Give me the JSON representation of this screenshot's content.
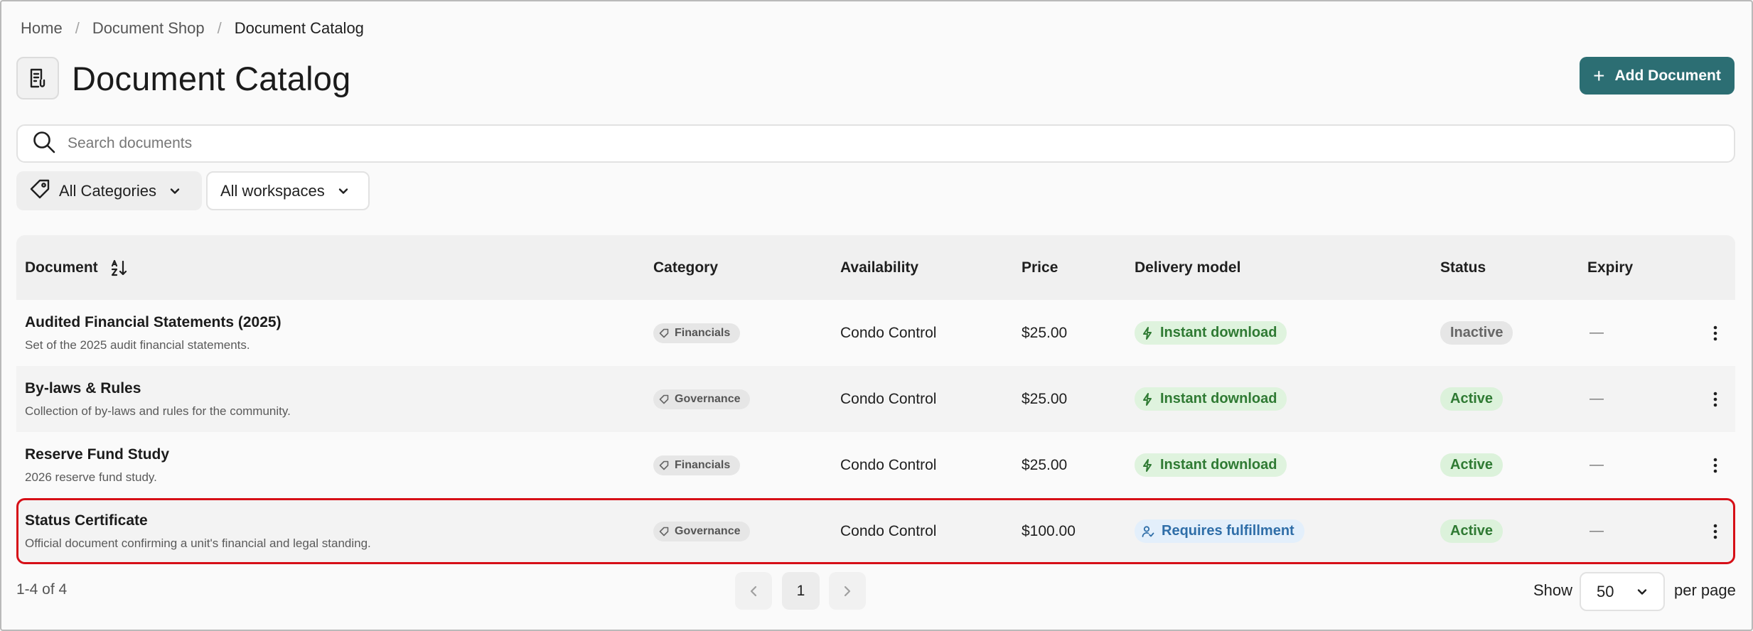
{
  "breadcrumb": {
    "items": [
      "Home",
      "Document Shop",
      "Document Catalog"
    ],
    "separator": "/"
  },
  "header": {
    "title": "Document Catalog",
    "icon": "document-list-icon",
    "add_button": "Add Document"
  },
  "search": {
    "placeholder": "Search documents",
    "value": ""
  },
  "filters": {
    "category": "All Categories",
    "workspace": "All workspaces"
  },
  "table": {
    "columns": [
      "Document",
      "Category",
      "Availability",
      "Price",
      "Delivery model",
      "Status",
      "Expiry"
    ],
    "rows": [
      {
        "title": "Audited Financial Statements (2025)",
        "description": "Set of the 2025 audit financial statements.",
        "category": "Financials",
        "availability": "Condo Control",
        "price": "$25.00",
        "delivery": "Instant download",
        "delivery_type": "instant",
        "status": "Inactive",
        "expiry": "—"
      },
      {
        "title": "By-laws & Rules",
        "description": "Collection of by-laws and rules for the community.",
        "category": "Governance",
        "availability": "Condo Control",
        "price": "$25.00",
        "delivery": "Instant download",
        "delivery_type": "instant",
        "status": "Active",
        "expiry": "—"
      },
      {
        "title": "Reserve Fund Study",
        "description": "2026 reserve fund study.",
        "category": "Financials",
        "availability": "Condo Control",
        "price": "$25.00",
        "delivery": "Instant download",
        "delivery_type": "instant",
        "status": "Active",
        "expiry": "—"
      },
      {
        "title": "Status Certificate",
        "description": "Official document confirming a unit's financial and legal standing.",
        "category": "Governance",
        "availability": "Condo Control",
        "price": "$100.00",
        "delivery": "Requires fulfillment",
        "delivery_type": "fulfill",
        "status": "Active",
        "expiry": "—"
      }
    ]
  },
  "pagination": {
    "summary": "1-4 of 4",
    "current_page": "1",
    "show_label": "Show",
    "per_page": "50",
    "per_page_label": "per page"
  },
  "colors": {
    "accent": "#2c6e73",
    "highlight": "#d60f17",
    "success": "#2f7a33",
    "info": "#2f6ea8"
  }
}
